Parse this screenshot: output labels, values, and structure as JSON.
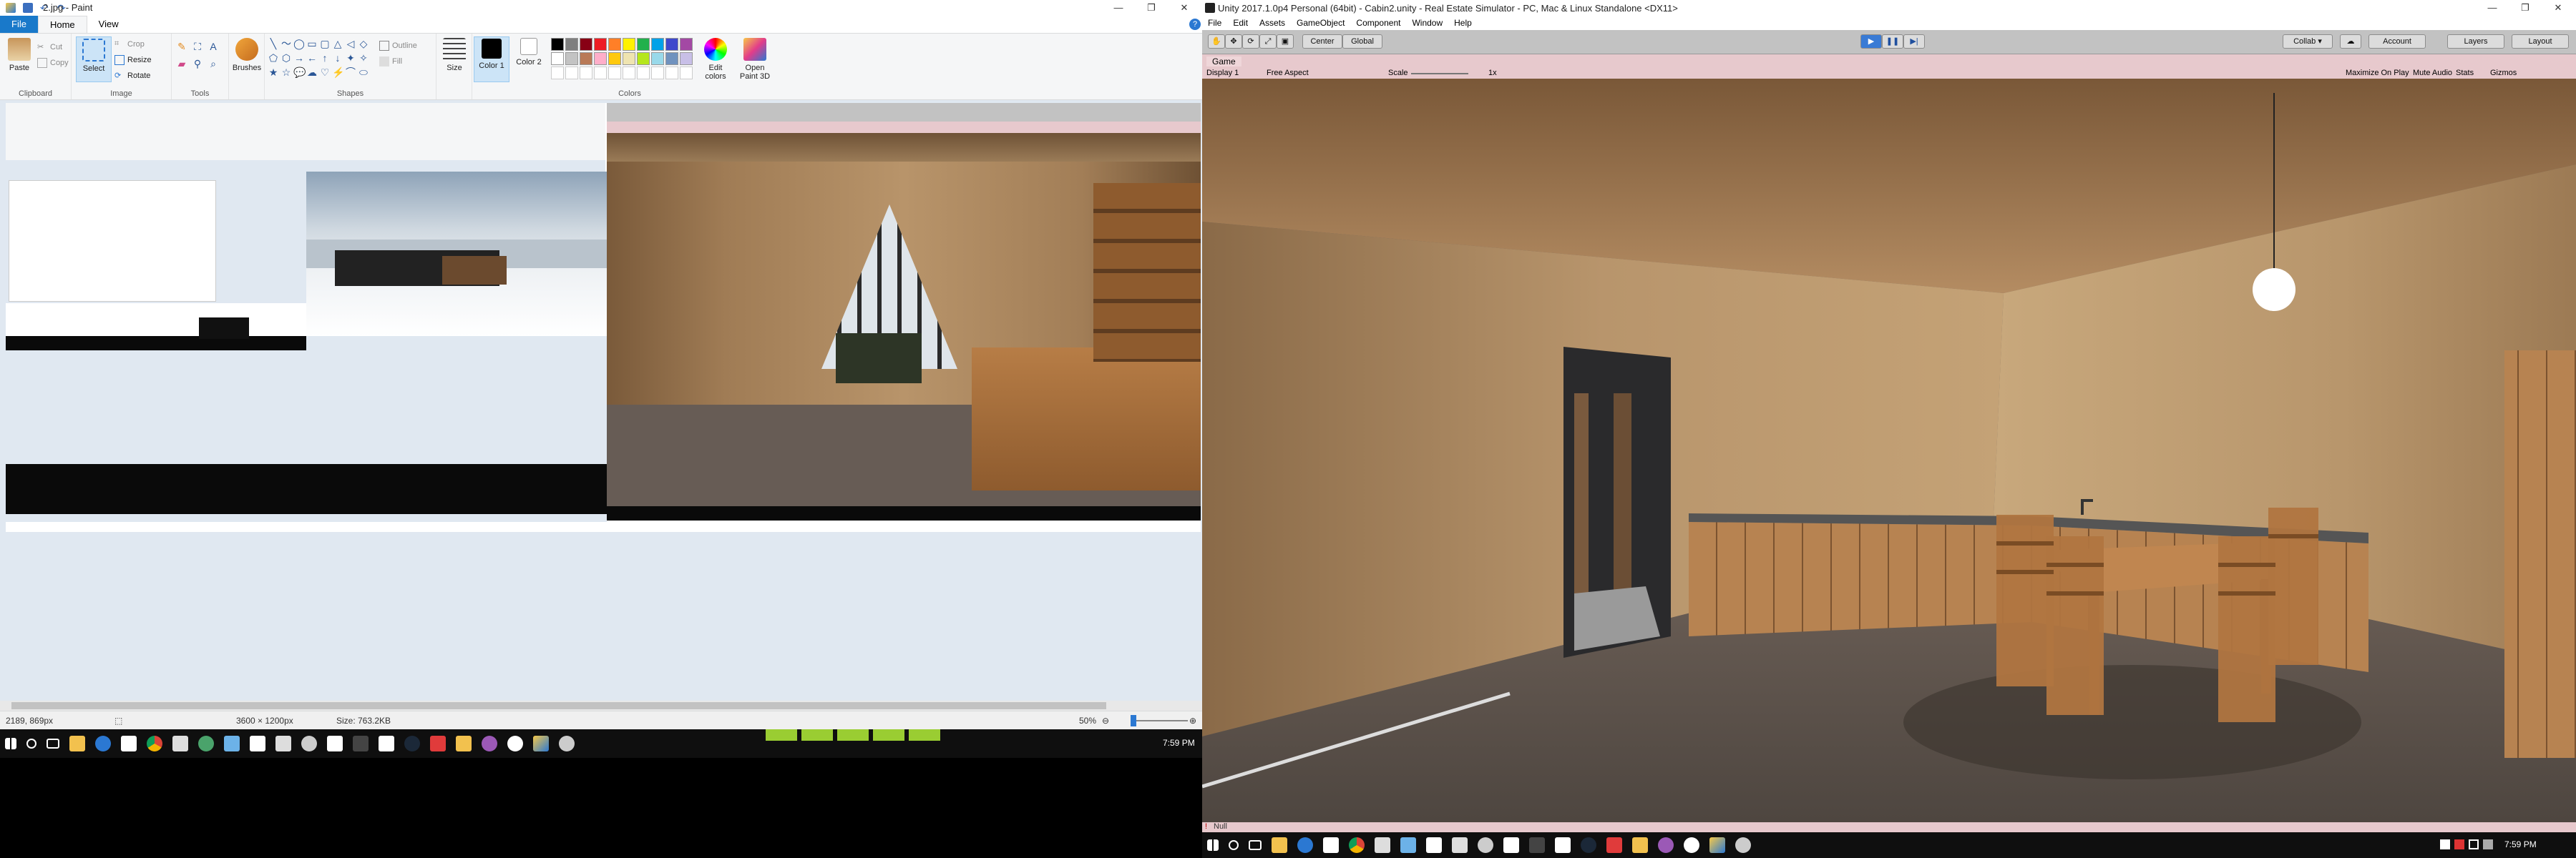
{
  "paint": {
    "title": "2.jpg - Paint",
    "tabs": [
      "File",
      "Home",
      "View"
    ],
    "groups": {
      "clipboard": {
        "label": "Clipboard",
        "paste": "Paste",
        "cut": "Cut",
        "copy": "Copy"
      },
      "image": {
        "label": "Image",
        "select": "Select",
        "crop": "Crop",
        "resize": "Resize",
        "rotate": "Rotate"
      },
      "tools": {
        "label": "Tools"
      },
      "brushes": {
        "label": "Brushes"
      },
      "shapes": {
        "label": "Shapes",
        "outline": "Outline",
        "fill": "Fill"
      },
      "size": {
        "label": "Size"
      },
      "colors": {
        "label": "Colors",
        "color1": "Color 1",
        "color2": "Color 2",
        "edit": "Edit colors",
        "paint3d": "Open Paint 3D"
      }
    },
    "palette": [
      "#000000",
      "#7f7f7f",
      "#880015",
      "#ed1c24",
      "#ff7f27",
      "#fff200",
      "#22b14c",
      "#00a2e8",
      "#3f48cc",
      "#a349a4",
      "#ffffff",
      "#c3c3c3",
      "#b97a57",
      "#ffaec9",
      "#ffc90e",
      "#efe4b0",
      "#b5e61d",
      "#99d9ea",
      "#7092be",
      "#c8bfe7"
    ],
    "status": {
      "cursor": "2189, 869px",
      "dimensions": "3600 × 1200px",
      "size": "Size: 763.2KB",
      "zoom": "50%"
    }
  },
  "taskbar_left": {
    "clock": "7:59 PM"
  },
  "taskbar_right": {
    "clock": "7:59 PM"
  },
  "unity": {
    "title": "Unity 2017.1.0p4 Personal (64bit) - Cabin2.unity - Real Estate Simulator - PC, Mac & Linux Standalone <DX11>",
    "menu": [
      "File",
      "Edit",
      "Assets",
      "GameObject",
      "Component",
      "Window",
      "Help"
    ],
    "toolbar": {
      "pivot": "Center",
      "space": "Global",
      "collab": "Collab ▾",
      "account": "Account",
      "layers": "Layers",
      "layout": "Layout"
    },
    "game_tab": "Game",
    "gamebar": {
      "display": "Display 1",
      "aspect": "Free Aspect",
      "scale_label": "Scale",
      "scale_value": "1x",
      "maximize": "Maximize On Play",
      "mute": "Mute Audio",
      "stats": "Stats",
      "gizmos": "Gizmos"
    },
    "console_text": "Null"
  }
}
